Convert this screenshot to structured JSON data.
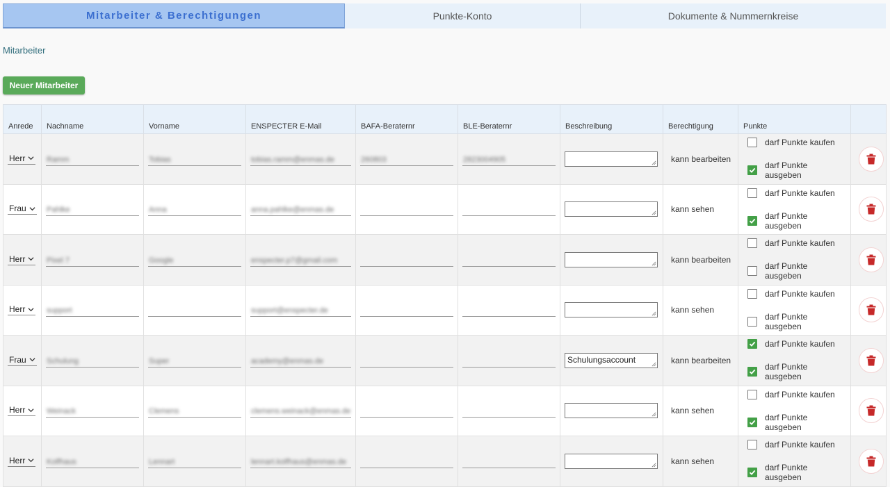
{
  "tabs": [
    {
      "label": "Mitarbeiter & Berechtigungen",
      "active": true
    },
    {
      "label": "Punkte-Konto",
      "active": false
    },
    {
      "label": "Dokumente & Nummernkreise",
      "active": false
    }
  ],
  "section_title": "Mitarbeiter",
  "new_button_label": "Neuer Mitarbeiter",
  "columns": [
    "Anrede",
    "Nachname",
    "Vorname",
    "ENSPECTER E-Mail",
    "BAFA-Beraternr",
    "BLE-Beraternr",
    "Beschreibung",
    "Berechtigung",
    "Punkte",
    ""
  ],
  "checkbox_labels": {
    "buy": "darf Punkte kaufen",
    "spend": "darf Punkte ausgeben"
  },
  "colors": {
    "accent_green": "#43a047",
    "tab_active": "#a6c6f1",
    "delete_red": "#c62828"
  },
  "rows": [
    {
      "anrede": "Herr",
      "nachname": "Ramm",
      "vorname": "Tobias",
      "email": "tobias.ramm@enmas.de",
      "bafa": "260803",
      "ble": "2823004905",
      "beschreibung": "",
      "berechtigung": "kann bearbeiten",
      "buy": false,
      "spend": true
    },
    {
      "anrede": "Frau",
      "nachname": "Pahlke",
      "vorname": "Anna",
      "email": "anna.pahlke@enmas.de",
      "bafa": "",
      "ble": "",
      "beschreibung": "",
      "berechtigung": "kann sehen",
      "buy": false,
      "spend": true
    },
    {
      "anrede": "Herr",
      "nachname": "Pixel 7",
      "vorname": "Google",
      "email": "enspecter.p7@gmail.com",
      "bafa": "",
      "ble": "",
      "beschreibung": "",
      "berechtigung": "kann bearbeiten",
      "buy": false,
      "spend": false
    },
    {
      "anrede": "Herr",
      "nachname": "support",
      "vorname": "",
      "email": "support@enspecter.de",
      "bafa": "",
      "ble": "",
      "beschreibung": "",
      "berechtigung": "kann sehen",
      "buy": false,
      "spend": false
    },
    {
      "anrede": "Frau",
      "nachname": "Schulung",
      "vorname": "Super",
      "email": "academy@enmas.de",
      "bafa": "",
      "ble": "",
      "beschreibung": "Schulungsaccount",
      "berechtigung": "kann bearbeiten",
      "buy": true,
      "spend": true
    },
    {
      "anrede": "Herr",
      "nachname": "Weinack",
      "vorname": "Clemens",
      "email": "clemens.weinack@enmas.de",
      "bafa": "",
      "ble": "",
      "beschreibung": "",
      "berechtigung": "kann sehen",
      "buy": false,
      "spend": true
    },
    {
      "anrede": "Herr",
      "nachname": "Kolfhaus",
      "vorname": "Lennart",
      "email": "lennart.kolfhaus@enmas.de",
      "bafa": "",
      "ble": "",
      "beschreibung": "",
      "berechtigung": "kann sehen",
      "buy": false,
      "spend": true
    }
  ]
}
